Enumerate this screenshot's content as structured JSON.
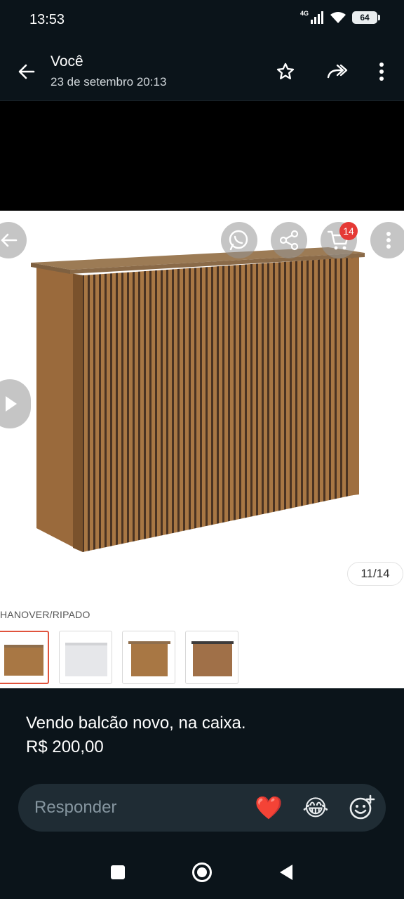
{
  "status": {
    "time": "13:53",
    "network": "4G",
    "battery": "64"
  },
  "header": {
    "sender": "Você",
    "date": "23 de setembro 20:13"
  },
  "media": {
    "cart_count": "14",
    "page_counter": "11/14",
    "variant_label": "HANOVER/RIPADO",
    "thumbnails": [
      "wood",
      "white",
      "wood",
      "dark-top"
    ]
  },
  "caption": {
    "line1": "Vendo balcão novo, na caixa.",
    "line2": "R$ 200,00"
  },
  "reply": {
    "placeholder": "Responder",
    "emoji1": "❤️",
    "emoji2": "😂"
  },
  "icons": [
    "back-arrow-icon",
    "star-icon",
    "forward-icon",
    "more-vert-icon",
    "whatsapp-icon",
    "share-icon",
    "cart-icon",
    "play-icon",
    "emoji-add-icon",
    "recents-icon",
    "home-icon",
    "back-icon"
  ],
  "colors": {
    "background": "#0b141a",
    "reply_bg": "#1f2c34",
    "badge": "#e53935",
    "wood": "#a87744"
  }
}
